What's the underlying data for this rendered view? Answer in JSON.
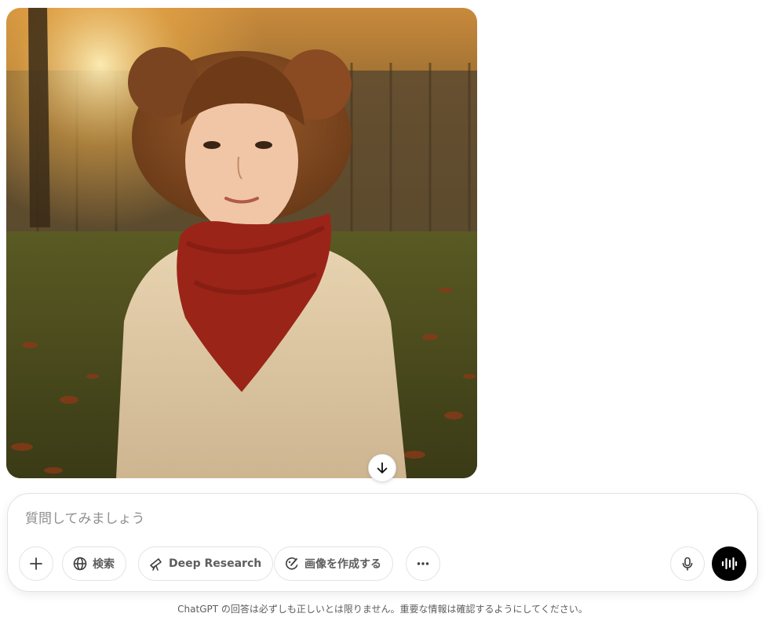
{
  "image": {
    "icon": "generated-portrait-image"
  },
  "scroll_button": {
    "icon": "arrow-down-icon"
  },
  "composer": {
    "placeholder": "質問してみましょう",
    "value": "",
    "tools": {
      "add": {
        "icon": "plus-icon"
      },
      "search": {
        "label": "検索",
        "icon": "globe-icon"
      },
      "deep_research": {
        "label": "Deep Research",
        "icon": "telescope-icon"
      },
      "create_image": {
        "label": "画像を作成する",
        "icon": "image-brush-icon"
      },
      "more": {
        "icon": "more-dots-icon"
      }
    },
    "mic": {
      "icon": "microphone-icon"
    },
    "voice": {
      "icon": "voice-mode-icon"
    }
  },
  "footer": {
    "disclaimer": "ChatGPT の回答は必ずしも正しいとは限りません。重要な情報は確認するようにしてください。"
  }
}
